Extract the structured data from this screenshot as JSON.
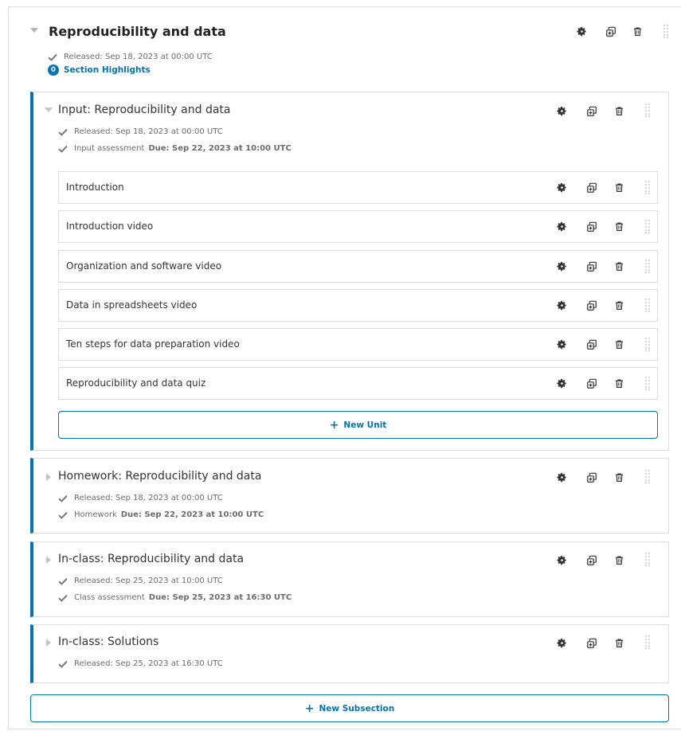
{
  "section": {
    "title": "Reproducibility and data",
    "released": "Released: Sep 18, 2023 at 00:00 UTC",
    "highlights_count": "0",
    "highlights_label": "Section Highlights"
  },
  "subsections": [
    {
      "title": "Input: Reproducibility and data",
      "released": "Released: Sep 18, 2023 at 00:00 UTC",
      "assessment": "Input assessment",
      "due": "Due: Sep 22, 2023 at 10:00 UTC",
      "units": [
        "Introduction",
        "Introduction video",
        "Organization and software video",
        "Data in spreadsheets video",
        "Ten steps for data preparation video",
        "Reproducibility and data quiz"
      ],
      "new_unit_label": "New Unit"
    },
    {
      "title": "Homework: Reproducibility and data",
      "released": "Released: Sep 18, 2023 at 00:00 UTC",
      "assessment": "Homework",
      "due": "Due: Sep 22, 2023 at 10:00 UTC"
    },
    {
      "title": "In-class: Reproducibility and data",
      "released": "Released: Sep 25, 2023 at 10:00 UTC",
      "assessment": "Class assessment",
      "due": "Due: Sep 25, 2023 at 16:30 UTC"
    },
    {
      "title": "In-class: Solutions",
      "released": "Released: Sep 25, 2023 at 16:30 UTC"
    }
  ],
  "new_subsection_label": "New Subsection",
  "icons": {
    "settings": "gear-icon",
    "duplicate": "duplicate-icon",
    "delete": "trash-icon",
    "drag": "drag-handle-icon",
    "expand": "caret-down-icon",
    "collapse": "caret-right-icon",
    "status": "check-icon"
  },
  "colors": {
    "accent": "#0075b4",
    "border": "#dcdcdc",
    "icon": "#333333"
  }
}
